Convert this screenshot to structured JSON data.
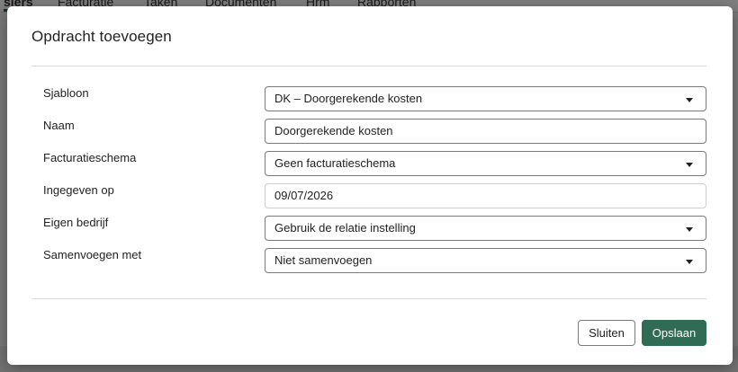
{
  "background_nav": [
    "siers",
    "Facturatie",
    "Taken",
    "Documenten",
    "Hrm",
    "Rapporten"
  ],
  "modal": {
    "title": "Opdracht toevoegen",
    "fields": [
      {
        "label": "Sjabloon",
        "value": "DK – Doorgerekende kosten",
        "type": "select"
      },
      {
        "label": "Naam",
        "value": "Doorgerekende kosten",
        "type": "text"
      },
      {
        "label": "Facturatieschema",
        "value": "Geen facturatieschema",
        "type": "select"
      },
      {
        "label": "Ingegeven op",
        "value": "09/07/2026",
        "type": "readonly"
      },
      {
        "label": "Eigen bedrijf",
        "value": "Gebruik de relatie instelling",
        "type": "select"
      },
      {
        "label": "Samenvoegen met",
        "value": "Niet samenvoegen",
        "type": "select"
      }
    ],
    "buttons": {
      "close": "Sluiten",
      "save": "Opslaan"
    }
  },
  "colors": {
    "primary": "#2f6b55",
    "overlay": "rgba(0,0,0,0.5)"
  }
}
